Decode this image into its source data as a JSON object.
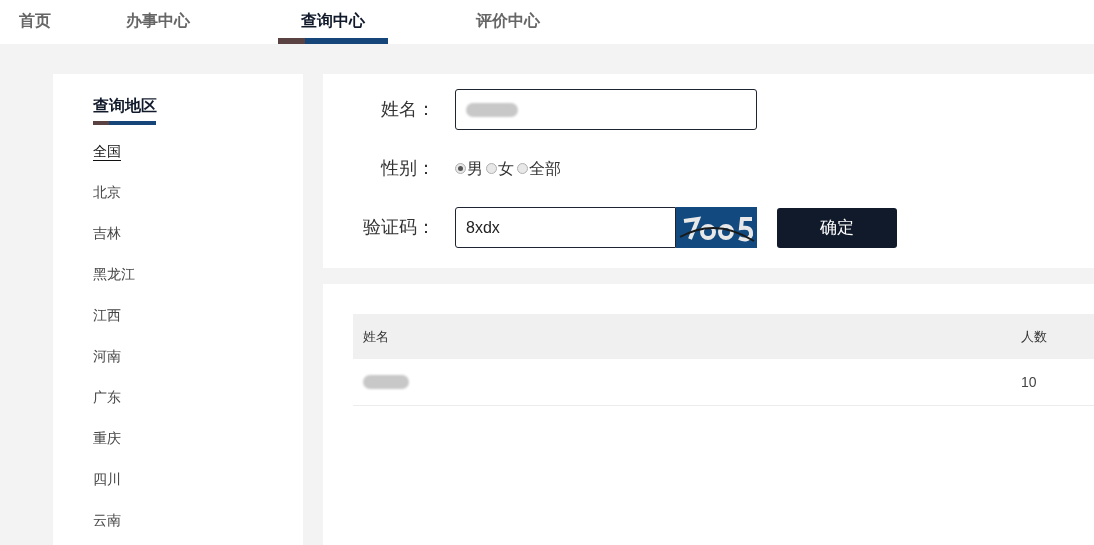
{
  "nav": [
    {
      "label": "首页",
      "selected": false
    },
    {
      "label": "办事中心",
      "selected": false
    },
    {
      "label": "查询中心",
      "selected": true
    },
    {
      "label": "评价中心",
      "selected": false
    }
  ],
  "sidebar": {
    "title": "查询地区",
    "items": [
      {
        "label": "全国",
        "selected": true
      },
      {
        "label": "北京",
        "selected": false
      },
      {
        "label": "吉林",
        "selected": false
      },
      {
        "label": "黑龙江",
        "selected": false
      },
      {
        "label": "江西",
        "selected": false
      },
      {
        "label": "河南",
        "selected": false
      },
      {
        "label": "广东",
        "selected": false
      },
      {
        "label": "重庆",
        "selected": false
      },
      {
        "label": "四川",
        "selected": false
      },
      {
        "label": "云南",
        "selected": false
      }
    ]
  },
  "form": {
    "rows": [
      {
        "kind": "redacted_input",
        "label": "姓名："
      },
      {
        "kind": "radio",
        "label": "性别：",
        "options": [
          {
            "label": "男",
            "selected": true
          },
          {
            "label": "女",
            "selected": false
          },
          {
            "label": "全部",
            "selected": false
          }
        ]
      },
      {
        "kind": "captcha",
        "label": "验证码：",
        "value": "8xdx",
        "button": "确定"
      }
    ]
  },
  "table": {
    "columns": [
      "姓名",
      "人数"
    ],
    "rows": [
      {
        "cells": [
          {
            "kind": "redacted"
          },
          {
            "kind": "text",
            "text": "10"
          }
        ]
      }
    ]
  }
}
